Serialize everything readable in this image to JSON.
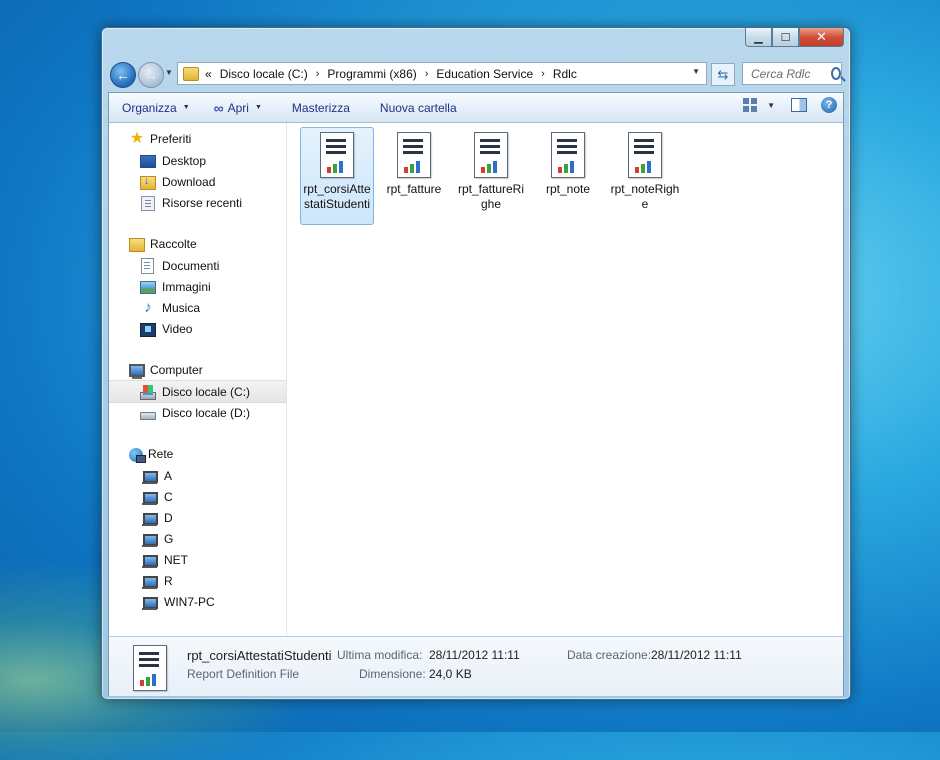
{
  "address": {
    "overflow_marker": "«",
    "crumbs": [
      "Disco locale (C:)",
      "Programmi (x86)",
      "Education Service",
      "Rdlc"
    ],
    "search_placeholder": "Cerca Rdlc"
  },
  "toolbar": {
    "organize": "Organizza",
    "open": "Apri",
    "burn": "Masterizza",
    "new_folder": "Nuova cartella"
  },
  "nav": {
    "favorites": {
      "label": "Preferiti",
      "items": [
        "Desktop",
        "Download",
        "Risorse recenti"
      ]
    },
    "libraries": {
      "label": "Raccolte",
      "items": [
        "Documenti",
        "Immagini",
        "Musica",
        "Video"
      ]
    },
    "computer": {
      "label": "Computer",
      "items": [
        "Disco locale (C:)",
        "Disco locale (D:)"
      ],
      "selected": "Disco locale (C:)"
    },
    "network": {
      "label": "Rete",
      "items": [
        "A",
        "C",
        "D",
        "G",
        "NET",
        "R",
        "WIN7-PC"
      ]
    }
  },
  "files": [
    {
      "name": "rpt_corsiAttestatiStudenti",
      "selected": true
    },
    {
      "name": "rpt_fatture",
      "selected": false
    },
    {
      "name": "rpt_fattureRighe",
      "selected": false
    },
    {
      "name": "rpt_note",
      "selected": false
    },
    {
      "name": "rpt_noteRighe",
      "selected": false
    }
  ],
  "details": {
    "file_name": "rpt_corsiAttestatiStudenti",
    "file_type": "Report Definition File",
    "modified_label": "Ultima modifica:",
    "modified_value": "28/11/2012 11:11",
    "size_label": "Dimensione:",
    "size_value": "24,0 KB",
    "created_label": "Data creazione:",
    "created_value": "28/11/2012 11:11"
  },
  "colors": {
    "selection": "#cde6fb",
    "toolbar_text": "#1e3287",
    "close_button": "#c13c26"
  }
}
